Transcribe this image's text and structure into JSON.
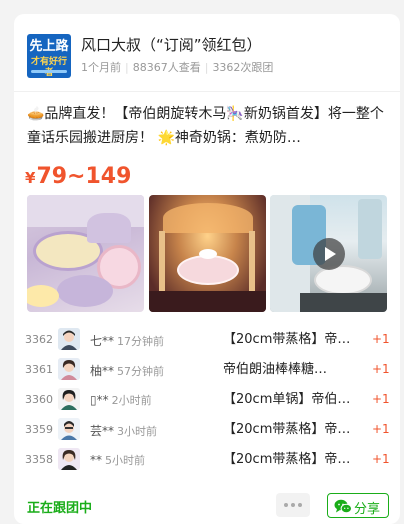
{
  "header": {
    "avatar_text_1": "先上路",
    "avatar_text_2": "才有好行者",
    "title": "风口大叔（“订阅”领红包）",
    "time_ago": "1个月前",
    "views": "88367人查看",
    "followers": "3362次跟团"
  },
  "post": {
    "description": "🥧品牌直发！【帝伯朗旋转木马🎠新奶锅首发】将一整个童话乐园搬进厨房！ 🌟神奇奶锅：煮奶防…",
    "price_currency": "¥",
    "price_range": "79~149"
  },
  "media": {
    "thumbnails": [
      "pastel-cookware-set",
      "carousel-pot",
      "kitchen-video"
    ],
    "play_icon": "play-icon"
  },
  "orders": [
    {
      "num": "3362",
      "name": "七**",
      "time": "17分钟前",
      "product": "【20cm带蒸格】帝…",
      "qty": "+1"
    },
    {
      "num": "3361",
      "name": "柚**",
      "time": "57分钟前",
      "product": "帝伯朗油棒棒糖…",
      "qty": "+1"
    },
    {
      "num": "3360",
      "name": "▯**",
      "time": "2小时前",
      "product": "【20cm单锅】帝伯…",
      "qty": "+1"
    },
    {
      "num": "3359",
      "name": "芸**",
      "time": "3小时前",
      "product": "【20cm带蒸格】帝…",
      "qty": "+1"
    },
    {
      "num": "3358",
      "name": "**",
      "time": "5小时前",
      "product": "【20cm带蒸格】帝…",
      "qty": "+1"
    }
  ],
  "footer": {
    "status": "正在跟团中",
    "share_label": "分享"
  },
  "colors": {
    "accent_orange": "#f0542d",
    "wechat_green": "#1aad19"
  }
}
